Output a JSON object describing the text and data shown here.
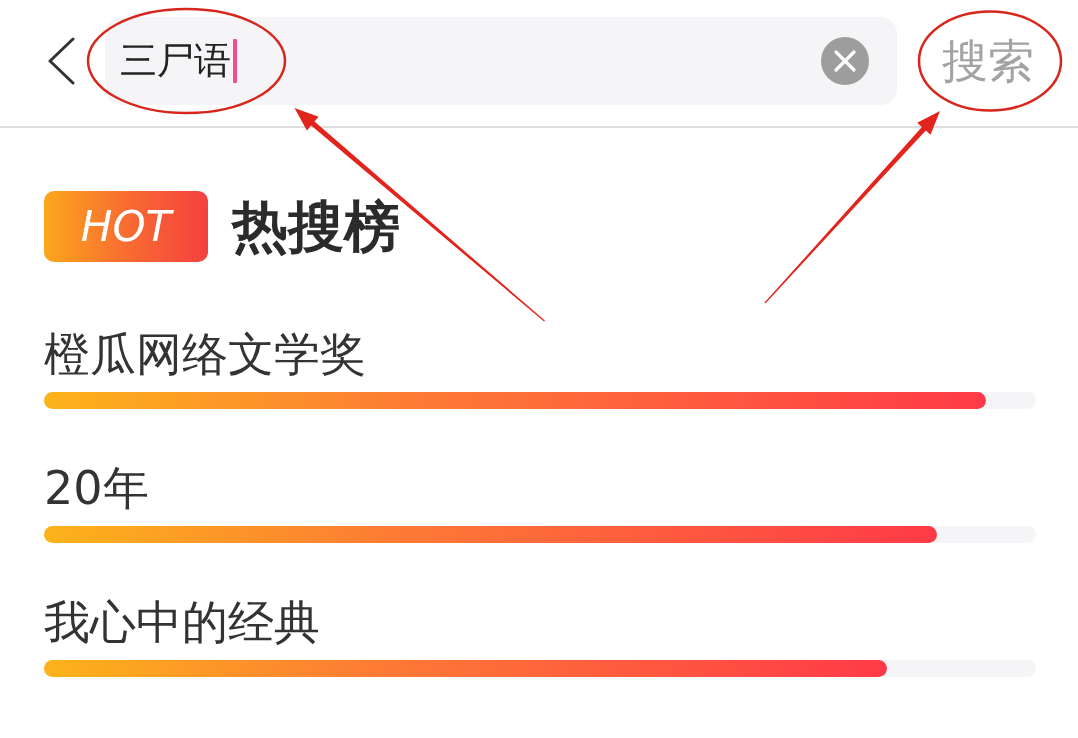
{
  "search_field": {
    "value": "三尸语",
    "focused": true,
    "circled": true
  },
  "search_button": {
    "label": "搜索",
    "circled": true
  },
  "hot_list": {
    "badge": "HOT",
    "title": "热搜榜",
    "items": [
      {
        "label": "橙瓜网络文学奖",
        "level": 0.95
      },
      {
        "label": "20年",
        "level": 0.9
      },
      {
        "label": "我心中的经典",
        "level": 0.85
      }
    ]
  }
}
